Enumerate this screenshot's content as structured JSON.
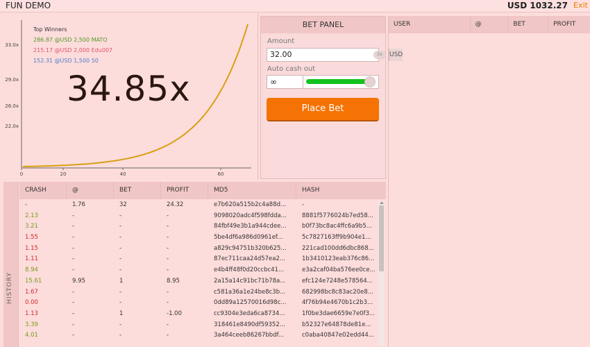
{
  "app": {
    "title": "FUN DEMO",
    "balance": "USD 1032.27",
    "exit_label": "Exit"
  },
  "chart_data": {
    "type": "line",
    "title": "",
    "xlabel": "",
    "ylabel": "",
    "x_ticks": [
      "0",
      "20",
      "40",
      "60"
    ],
    "y_ticks": [
      "22.0x",
      "26.0x",
      "29.0x",
      "33.0x"
    ],
    "current_multiplier": "34.85x",
    "series": [
      {
        "values": []
      }
    ],
    "grid": false,
    "line_color": "#d8a010"
  },
  "top_winners": {
    "title": "Top Winners",
    "entries": [
      {
        "text": "286.87 @USD 2,500 MATO",
        "color": "#4f9a24"
      },
      {
        "text": "215.17 @USD 2,000 Edu007",
        "color": "#e0556a"
      },
      {
        "text": "152.31 @USD 1,500 50",
        "color": "#4a80c8"
      }
    ]
  },
  "bet_panel": {
    "title": "BET PANEL",
    "amount_label": "Amount",
    "amount_value": "32.00",
    "x2_label": "2x",
    "currency_label": "USD",
    "autocash_label": "Auto cash out",
    "autocash_value": "∞",
    "slider_level": 1.0,
    "place_bet_label": "Place Bet"
  },
  "users": {
    "columns": [
      "USER",
      "@",
      "BET",
      "PROFIT"
    ]
  },
  "history": {
    "side_label": "HISTORY",
    "columns": [
      "CRASH",
      "@",
      "BET",
      "PROFIT",
      "MD5",
      "HASH"
    ],
    "rows": [
      {
        "crash": "-",
        "crash_color": "dark",
        "at": "1.76",
        "bet": "32",
        "profit": "24.32",
        "md5": "e7b620a515b2c4a88d...",
        "hash": "-"
      },
      {
        "crash": "2.13",
        "crash_color": "green",
        "at": "-",
        "bet": "-",
        "profit": "-",
        "md5": "9098020adc4f598fdda...",
        "hash": "8881f5776024b7ed58..."
      },
      {
        "crash": "3.21",
        "crash_color": "green",
        "at": "-",
        "bet": "-",
        "profit": "-",
        "md5": "84fbf49e3b1a944cdee...",
        "hash": "b0f73bc8ac4ffc6a9b5..."
      },
      {
        "crash": "1.55",
        "crash_color": "red",
        "at": "-",
        "bet": "-",
        "profit": "-",
        "md5": "5be4df6a986d0961ef...",
        "hash": "5c7827163ff9b904e1..."
      },
      {
        "crash": "1.15",
        "crash_color": "red",
        "at": "-",
        "bet": "-",
        "profit": "-",
        "md5": "a829c94751b320b625...",
        "hash": "221cad100dd6dbc868..."
      },
      {
        "crash": "1.11",
        "crash_color": "red",
        "at": "-",
        "bet": "-",
        "profit": "-",
        "md5": "87ec711caa24d57ea2...",
        "hash": "1b3410123eab376c86..."
      },
      {
        "crash": "8.94",
        "crash_color": "green",
        "at": "-",
        "bet": "-",
        "profit": "-",
        "md5": "e4b4ff48f0d20ccbc41...",
        "hash": "e3a2caf04ba576ee0ce..."
      },
      {
        "crash": "15.61",
        "crash_color": "green",
        "at": "9.95",
        "bet": "1",
        "profit": "8.95",
        "md5": "2a15a14c91bc71b78a...",
        "hash": "efc124e7248e578564..."
      },
      {
        "crash": "1.67",
        "crash_color": "red",
        "at": "-",
        "bet": "-",
        "profit": "-",
        "md5": "c581a36a1e24be8c3b...",
        "hash": "682998bc8c83ac20e8..."
      },
      {
        "crash": "0.00",
        "crash_color": "red",
        "at": "-",
        "bet": "-",
        "profit": "-",
        "md5": "0dd89a12570016d98c...",
        "hash": "4f76b94e4670b1c2b3..."
      },
      {
        "crash": "1.13",
        "crash_color": "red",
        "at": "-",
        "bet": "1",
        "profit": "-1.00",
        "md5": "cc9304e3eda6ca8734...",
        "hash": "1f0be3dae6659e7e0f3..."
      },
      {
        "crash": "3.39",
        "crash_color": "green",
        "at": "-",
        "bet": "-",
        "profit": "-",
        "md5": "318461e8490df59352...",
        "hash": "b52327e64878de81e..."
      },
      {
        "crash": "4.01",
        "crash_color": "green",
        "at": "-",
        "bet": "-",
        "profit": "-",
        "md5": "3a464ceeb86267bbdf...",
        "hash": "c0aba40847e02edd44..."
      }
    ]
  }
}
